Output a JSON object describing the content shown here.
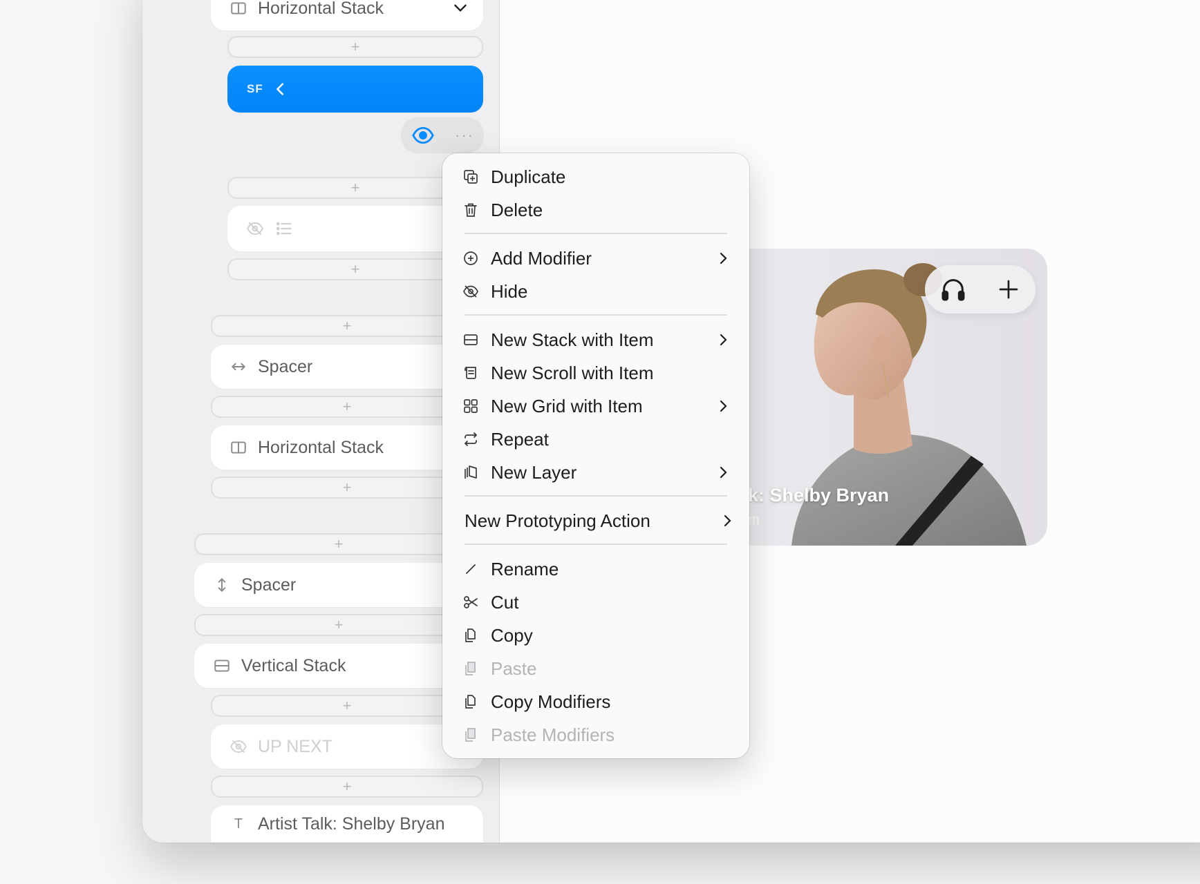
{
  "sidebar": {
    "rows": {
      "hstack_top": "Horizontal Stack",
      "sf_badge": "SF",
      "spacer_h": "Spacer",
      "hstack_mid": "Horizontal Stack",
      "spacer_v": "Spacer",
      "vstack": "Vertical Stack",
      "up_next": "UP NEXT",
      "artist_talk": "Artist Talk: Shelby Bryan"
    },
    "slot_glyph": "+"
  },
  "card": {
    "title": "k: Shelby Bryan",
    "subtitle": "m"
  },
  "context_menu": {
    "items": {
      "duplicate": "Duplicate",
      "delete": "Delete",
      "add_modifier": "Add Modifier",
      "hide": "Hide",
      "new_stack": "New Stack with Item",
      "new_scroll": "New Scroll with Item",
      "new_grid": "New Grid with Item",
      "repeat": "Repeat",
      "new_layer": "New Layer",
      "new_prototyping_action": "New Prototyping Action",
      "rename": "Rename",
      "cut": "Cut",
      "copy": "Copy",
      "paste": "Paste",
      "copy_modifiers": "Copy Modifiers",
      "paste_modifiers": "Paste Modifiers"
    },
    "disabled": [
      "paste",
      "paste_modifiers"
    ]
  },
  "colors": {
    "accent": "#0a8cff",
    "menu_bg": "#fafafa",
    "sidebar_bg": "#efeff1"
  }
}
